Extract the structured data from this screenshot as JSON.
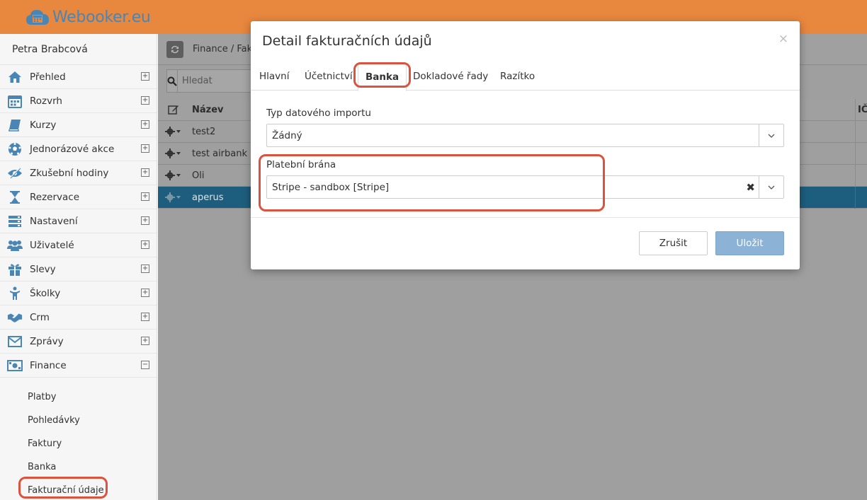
{
  "brand": {
    "name": "Webooker.eu"
  },
  "sidebar": {
    "user": "Petra Brabcová",
    "items": [
      {
        "label": "Přehled",
        "icon": "home-icon"
      },
      {
        "label": "Rozvrh",
        "icon": "calendar-icon"
      },
      {
        "label": "Kurzy",
        "icon": "book-icon"
      },
      {
        "label": "Jednorázové akce",
        "icon": "soccer-ball-icon"
      },
      {
        "label": "Zkušební hodiny",
        "icon": "eye-slash-icon"
      },
      {
        "label": "Rezervace",
        "icon": "hourglass-icon"
      },
      {
        "label": "Nastavení",
        "icon": "server-icon"
      },
      {
        "label": "Uživatelé",
        "icon": "users-icon"
      },
      {
        "label": "Slevy",
        "icon": "gift-icon"
      },
      {
        "label": "Školky",
        "icon": "child-icon"
      },
      {
        "label": "Crm",
        "icon": "handshake-icon"
      },
      {
        "label": "Zprávy",
        "icon": "envelope-icon"
      },
      {
        "label": "Finance",
        "icon": "money-icon"
      }
    ],
    "finance_sub": [
      "Platby",
      "Pohledávky",
      "Faktury",
      "Banka",
      "Fakturační údaje"
    ]
  },
  "main": {
    "breadcrumb": "Finance / Fak",
    "search_placeholder": "Hledat",
    "table": {
      "header_name": "Název",
      "header_ic": "IČ",
      "rows": [
        "test2",
        "test airbank",
        "Oli",
        "aperus"
      ],
      "selected_row": 3
    }
  },
  "modal": {
    "title": "Detail fakturačních údajů",
    "close": "×",
    "tabs": [
      "Hlavní",
      "Účetnictví",
      "Banka",
      "Dokladové řady",
      "Razítko"
    ],
    "active_tab": "Banka",
    "fields": {
      "import_label": "Typ datového importu",
      "import_value": "Žádný",
      "gateway_label": "Platební brána",
      "gateway_value": "Stripe - sandbox [Stripe]"
    },
    "buttons": {
      "cancel": "Zrušit",
      "save": "Uložit"
    }
  },
  "colors": {
    "topbar": "#e8873e",
    "brand": "#4a86b5",
    "selected_row": "#1d5e7e",
    "save_button": "#8cb2d6",
    "highlight": "#d9533f"
  }
}
